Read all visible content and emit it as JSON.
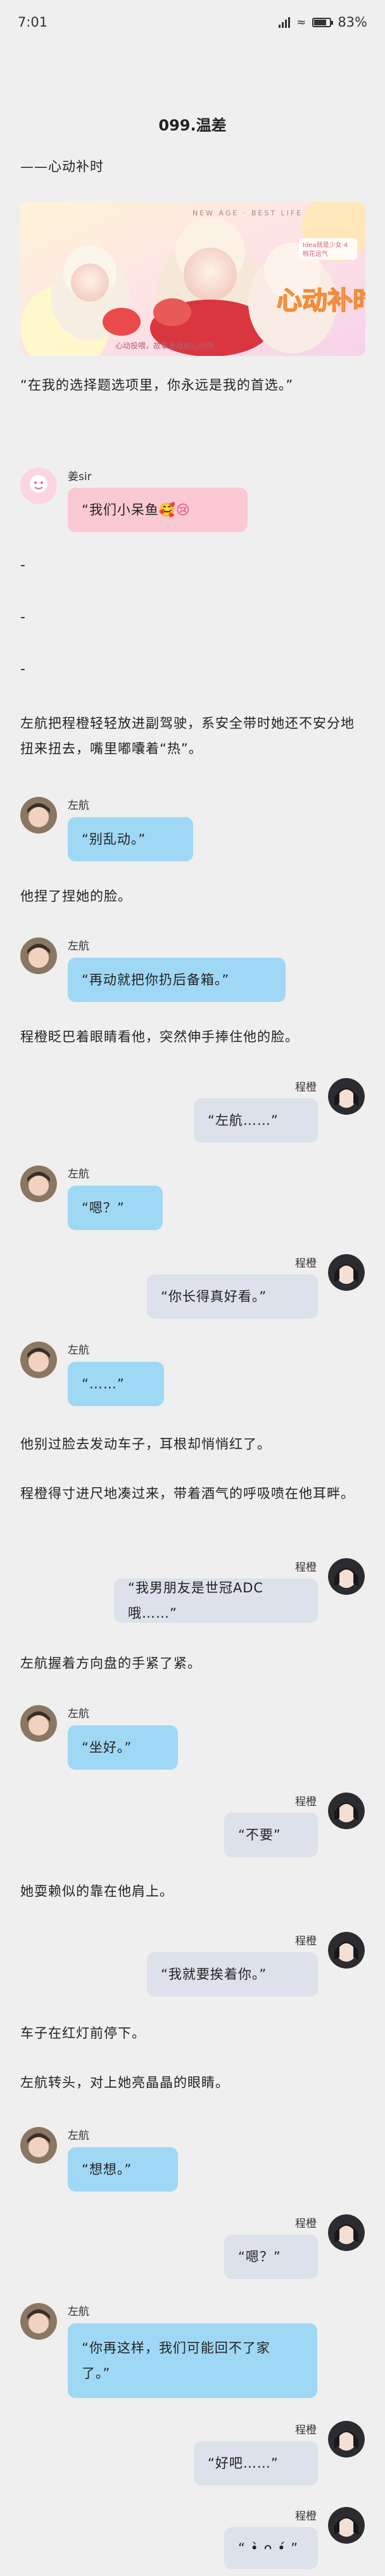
{
  "status": {
    "time": "7:01",
    "battery_text": "83%",
    "battery_level": 0.83
  },
  "chapter": {
    "title": "099.温差",
    "subtitle": "——心动补时",
    "opening_quote": "“在我的选择题选项里，你永远是我的首选。”"
  },
  "banner": {
    "header_text": "NEW AGE · BEST LIFE",
    "tag_line1": "Idea就是少女·4",
    "tag_line2": "桃花运气",
    "title_text": "心动补时",
    "footer_text": "心动投喂，故事是我的心动啊"
  },
  "colors": {
    "background": "#efefef",
    "bubble_blue": "#9fd8f4",
    "bubble_grey": "#dde1ec",
    "bubble_pink": "#fbc9d3"
  },
  "speakers": {
    "zuohang": "左航",
    "chengcheng": "程橙",
    "author": "姜sir"
  },
  "messages": {
    "author_1": "“我们小呆鱼",
    "zh_1": "“别乱动。”",
    "zh_2": "“再动就把你扔后备箱。”",
    "cc_1": "“左航……”",
    "zh_3": "“嗯？”",
    "cc_2": "“你长得真好看。”",
    "zh_4": "“……”",
    "cc_3": "“我男朋友是世冠ADC哦……”",
    "zh_5": "“坐好。”",
    "cc_4": "“不要”",
    "cc_5": "“我就要挨着你。”",
    "zh_6": "“想想。”",
    "cc_6": "“嗯？”",
    "zh_7a": "“你再这样，我们可能回不了家",
    "zh_7b": "了。”",
    "cc_7": "“好吧……”",
    "cc_8": "“ •̀ ᴖ •́ ”"
  },
  "narration": {
    "n1": "左航把程橙轻轻放进副驾驶，系安全带时她还不安分地扭来扭去，嘴里嘟囔着“热”。",
    "n2": "他捏了捏她的脸。",
    "n3": "程橙眨巴着眼睛看他，突然伸手捧住他的脸。",
    "n4": "他别过脸去发动车子，耳根却悄悄红了。",
    "n5": "程橙得寸进尺地凑过来，带着酒气的呼吸喷在他耳畔。",
    "n6": "左航握着方向盘的手紧了紧。",
    "n7": "她耍赖似的靠在他肩上。",
    "n8": "车子在红灯前停下。",
    "n9": "左航转头，对上她亮晶晶的眼睛。"
  },
  "dashes": [
    "-",
    "-",
    "-"
  ]
}
